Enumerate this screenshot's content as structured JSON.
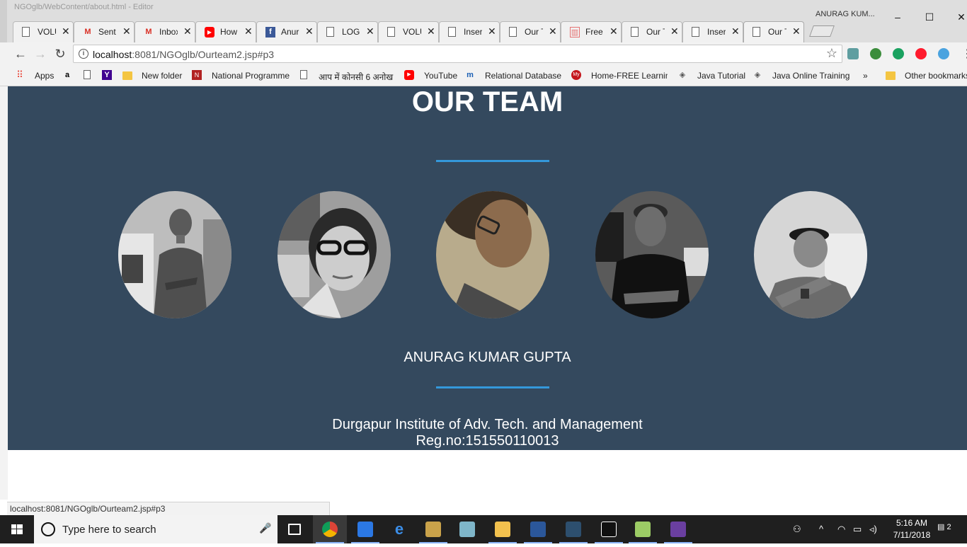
{
  "window": {
    "background_title": "NGOglb/WebContent/about.html - Editor",
    "profile_name": "ANURAG KUM...",
    "controls": {
      "minimize": "–",
      "maximize": "☐",
      "close": "✕"
    }
  },
  "tabs": [
    {
      "label": "VOLU",
      "icon": "document-icon"
    },
    {
      "label": "Sent",
      "icon": "gmail-icon"
    },
    {
      "label": "Inbox",
      "icon": "gmail-icon"
    },
    {
      "label": "How",
      "icon": "youtube-icon"
    },
    {
      "label": "Anur",
      "icon": "facebook-icon"
    },
    {
      "label": "LOGI",
      "icon": "document-icon"
    },
    {
      "label": "VOLU",
      "icon": "document-icon"
    },
    {
      "label": "Inser",
      "icon": "document-icon"
    },
    {
      "label": "Our T",
      "icon": "document-icon"
    },
    {
      "label": "Free",
      "icon": "template-icon"
    },
    {
      "label": "Our T",
      "icon": "document-icon"
    },
    {
      "label": "Inser",
      "icon": "document-icon"
    },
    {
      "label": "Our T",
      "icon": "document-icon",
      "active": true
    }
  ],
  "tab_close": "✕",
  "omnibox": {
    "host": "localhost",
    "path": ":8081/NGOglb/Ourteam2.jsp#p3"
  },
  "bookmarks": [
    {
      "label": "Apps",
      "icon": "apps-grid-icon"
    },
    {
      "label": "",
      "icon": "amazon-icon"
    },
    {
      "label": "",
      "icon": "document-icon"
    },
    {
      "label": "",
      "icon": "yahoo-icon"
    },
    {
      "label": "New folder",
      "icon": "folder-icon"
    },
    {
      "label": "National Programme",
      "icon": "nptel-icon"
    },
    {
      "label": "आप में कोनसी 6 अनोख",
      "icon": "document-icon"
    },
    {
      "label": "YouTube",
      "icon": "youtube-icon"
    },
    {
      "label": "Relational Database",
      "icon": "m-icon"
    },
    {
      "label": "Home-FREE Learning",
      "icon": "my-icon"
    },
    {
      "label": "Java Tutorial",
      "icon": "diamond-icon"
    },
    {
      "label": "Java Online Training",
      "icon": "diamond-icon"
    },
    {
      "label": "»",
      "icon": "overflow-chevron-icon"
    },
    {
      "label": "Other bookmarks",
      "icon": "folder-icon"
    }
  ],
  "page": {
    "title": "OUR TEAM",
    "member_name": "ANURAG KUMAR GUPTA",
    "institute": "Durgapur Institute of Adv. Tech. and Management",
    "reg_no": "Reg.no:151550110013",
    "accent_color": "#3498db",
    "background_color": "#34495e"
  },
  "status_bar": {
    "url": "localhost:8081/NGOglb/Ourteam2.jsp#p3"
  },
  "taskbar": {
    "search_placeholder": "Type here to search",
    "clock_time": "5:16 AM",
    "clock_date": "7/11/2018",
    "notification_count": "2"
  }
}
